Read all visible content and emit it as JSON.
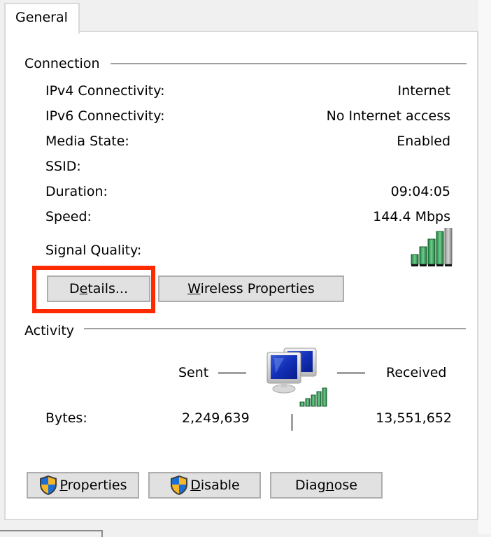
{
  "tabs": [
    {
      "label": "General",
      "active": true
    }
  ],
  "connection": {
    "title": "Connection",
    "rows": [
      {
        "label": "IPv4 Connectivity:",
        "value": "Internet"
      },
      {
        "label": "IPv6 Connectivity:",
        "value": "No Internet access"
      },
      {
        "label": "Media State:",
        "value": "Enabled"
      },
      {
        "label": "SSID:",
        "value": ""
      },
      {
        "label": "Duration:",
        "value": "09:04:05"
      },
      {
        "label": "Speed:",
        "value": "144.4 Mbps"
      }
    ],
    "signal_quality": {
      "label": "Signal Quality:",
      "bars_lit": 4,
      "bars_total": 5
    },
    "buttons": {
      "details": {
        "label": "Details...",
        "mnemonic_index": 1
      },
      "wireless_properties": {
        "label": "Wireless Properties",
        "mnemonic_index": 0
      }
    }
  },
  "activity": {
    "title": "Activity",
    "sent_label": "Sent",
    "received_label": "Received",
    "bytes_label": "Bytes:",
    "bytes_sent": "2,249,639",
    "bytes_received": "13,551,652",
    "icon": "network-computers-icon"
  },
  "footer_buttons": {
    "properties": {
      "label": "Properties",
      "mnemonic_index": 0,
      "icon": "uac-shield-icon"
    },
    "disable": {
      "label": "Disable",
      "mnemonic_index": 0,
      "icon": "uac-shield-icon"
    },
    "diagnose": {
      "label": "Diagnose",
      "mnemonic_index": 4
    }
  },
  "colors": {
    "highlight": "#ff2a00",
    "signal_green": "#2e8b4e",
    "button_face": "#e1e1e1"
  }
}
